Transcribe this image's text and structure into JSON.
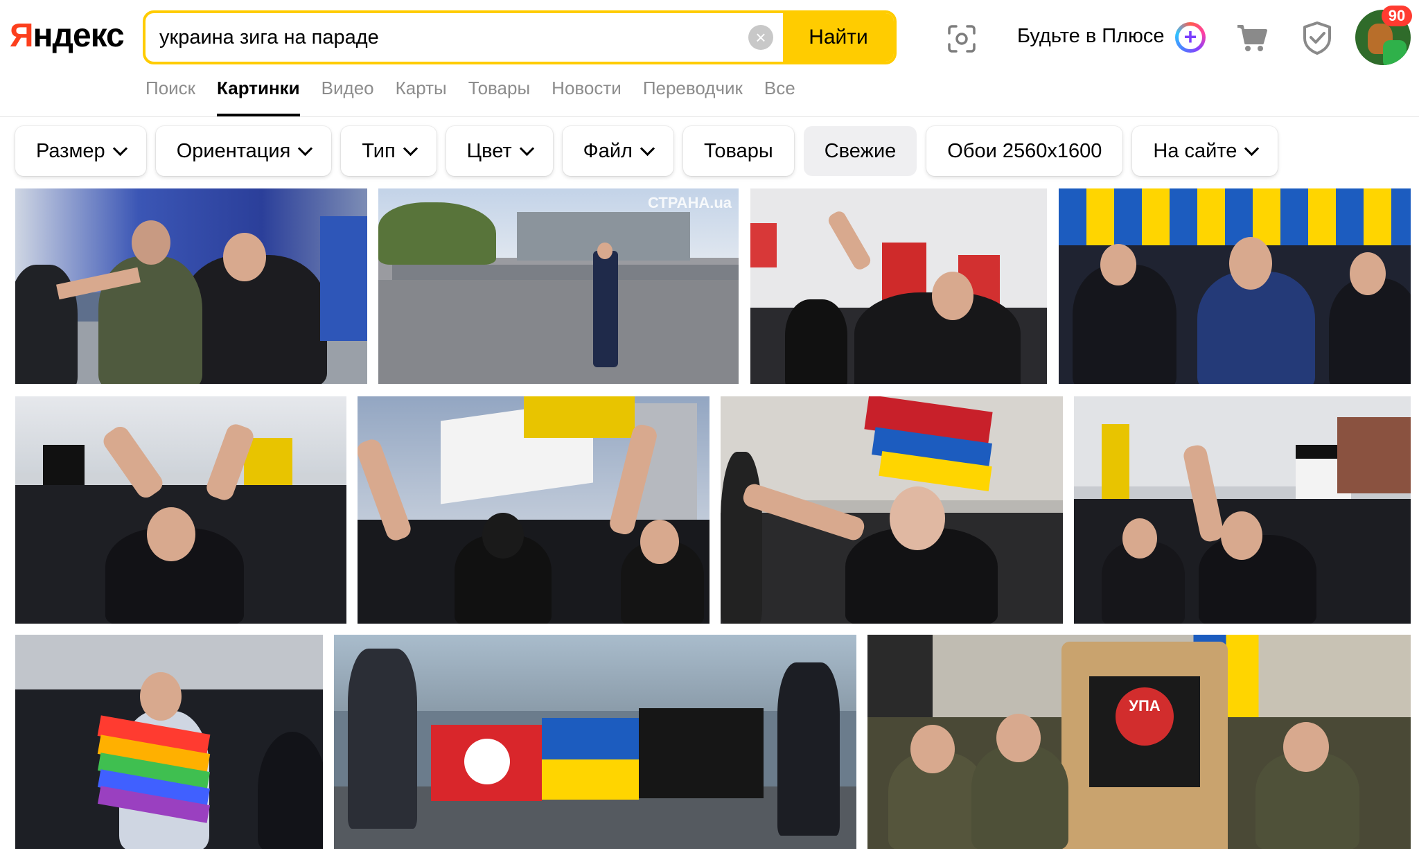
{
  "header": {
    "logo_first": "Я",
    "logo_rest": "ндекс",
    "search": {
      "value": "украина зига на параде",
      "clear_icon": "×",
      "button_label": "Найти"
    },
    "plus_label": "Будьте в Плюсе",
    "notification_count": "90"
  },
  "tabs": [
    {
      "label": "Поиск",
      "active": false
    },
    {
      "label": "Картинки",
      "active": true
    },
    {
      "label": "Видео",
      "active": false
    },
    {
      "label": "Карты",
      "active": false
    },
    {
      "label": "Товары",
      "active": false
    },
    {
      "label": "Новости",
      "active": false
    },
    {
      "label": "Переводчик",
      "active": false
    },
    {
      "label": "Все",
      "active": false
    }
  ],
  "filters": [
    {
      "label": "Размер",
      "dropdown": true
    },
    {
      "label": "Ориентация",
      "dropdown": true
    },
    {
      "label": "Тип",
      "dropdown": true
    },
    {
      "label": "Цвет",
      "dropdown": true
    },
    {
      "label": "Файл",
      "dropdown": true
    },
    {
      "label": "Товары",
      "dropdown": false
    },
    {
      "label": "Свежие",
      "dropdown": false,
      "active": true
    },
    {
      "label": "Обои 2560x1600",
      "dropdown": false
    },
    {
      "label": "На сайте",
      "dropdown": true
    }
  ],
  "results": {
    "watermark": "СТРАНА.ua",
    "flag_text": "УПА"
  },
  "colors": {
    "accent": "#ffcc00",
    "logo_red": "#fc3f1d",
    "badge_red": "#ff3b30",
    "ua_blue": "#1c5cbf",
    "ua_yellow": "#ffd500"
  }
}
